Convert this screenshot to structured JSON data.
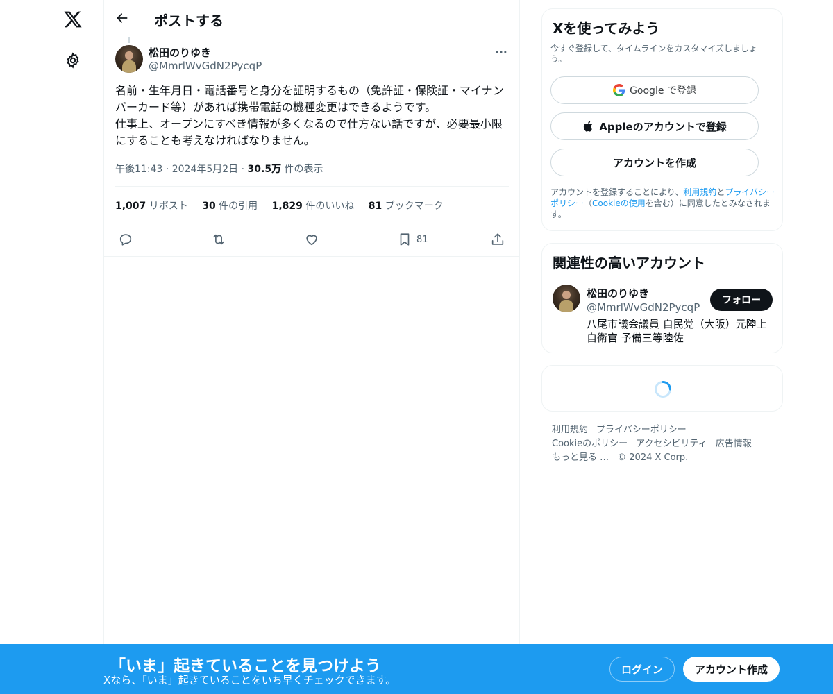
{
  "header": {
    "title": "ポストする"
  },
  "post": {
    "author_name": "松田のりゆき",
    "author_handle": "@MmrlWvGdN2PycqP",
    "text": "名前・生年月日・電話番号と身分を証明するもの（免許証・保険証・マイナンバーカード等）があれば携帯電話の機種変更はできるようです。\n仕事上、オープンにすべき情報が多くなるので仕方ない話ですが、必要最小限にすることも考えなければなりません。",
    "time": "午後11:43",
    "date": "2024年5月2日",
    "dot": "·",
    "views_count": "30.5万",
    "views_label": "件の表示",
    "stats": [
      {
        "count": "1,007",
        "label": "リポスト"
      },
      {
        "count": "30",
        "label": "件の引用"
      },
      {
        "count": "1,829",
        "label": "件のいいね"
      },
      {
        "count": "81",
        "label": "ブックマーク"
      }
    ],
    "bookmark_count": "81"
  },
  "signup_card": {
    "title": "Xを使ってみよう",
    "subtitle": "今すぐ登録して、タイムラインをカスタマイズしましょう。",
    "google_label": "Google で登録",
    "apple_label": "Appleのアカウントで登録",
    "create_label": "アカウントを作成",
    "legal_prefix": "アカウントを登録することにより、",
    "legal_terms": "利用規約",
    "legal_and": "と",
    "legal_privacy": "プライバシーポリシー",
    "legal_paren_open": "（",
    "legal_cookie": "Cookieの使用",
    "legal_suffix": "を含む）に同意したとみなされます。"
  },
  "related": {
    "title": "関連性の高いアカウント",
    "name": "松田のりゆき",
    "handle": "@MmrlWvGdN2PycqP",
    "follow_label": "フォロー",
    "bio": "八尾市議会議員 自民党（大阪）元陸上自衛官 予備三等陸佐"
  },
  "footer": {
    "links": [
      "利用規約",
      "プライバシーポリシー",
      "Cookieのポリシー",
      "アクセシビリティ",
      "広告情報",
      "もっと見る …",
      "© 2024 X Corp."
    ]
  },
  "bottom_bar": {
    "title": "「いま」起きていることを見つけよう",
    "subtitle": "Xなら、「いま」起きていることをいち早くチェックできます。",
    "login_label": "ログイン",
    "signup_label": "アカウント作成"
  },
  "colors": {
    "accent": "#1d9bf0",
    "text": "#0f1419",
    "muted": "#536471",
    "border": "#eff3f4"
  },
  "icons": [
    "x-logo-icon",
    "gear-icon",
    "back-arrow-icon",
    "more-icon",
    "reply-icon",
    "repost-icon",
    "like-icon",
    "bookmark-icon",
    "share-icon",
    "google-icon",
    "apple-icon",
    "loading-spinner-icon"
  ]
}
